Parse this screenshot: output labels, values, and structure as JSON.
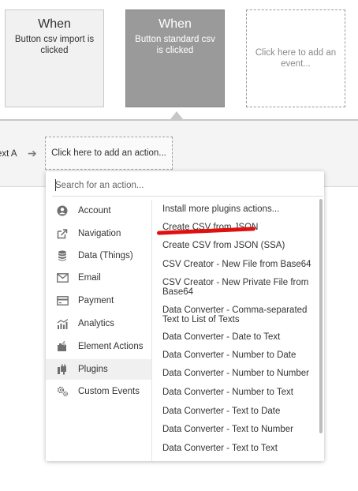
{
  "events": [
    {
      "when": "When",
      "desc": "Button csv import is clicked"
    },
    {
      "when": "When",
      "desc": "Button standard csv is clicked"
    },
    {
      "add_text": "Click here to add an event..."
    }
  ],
  "action_bar": {
    "step_label": "ext A",
    "add_action": "Click here to add an action..."
  },
  "search": {
    "placeholder": "Search for an action..."
  },
  "categories": [
    {
      "label": "Account",
      "icon": "account-icon"
    },
    {
      "label": "Navigation",
      "icon": "navigation-icon"
    },
    {
      "label": "Data (Things)",
      "icon": "database-icon"
    },
    {
      "label": "Email",
      "icon": "email-icon"
    },
    {
      "label": "Payment",
      "icon": "payment-icon"
    },
    {
      "label": "Analytics",
      "icon": "analytics-icon"
    },
    {
      "label": "Element Actions",
      "icon": "element-actions-icon"
    },
    {
      "label": "Plugins",
      "icon": "plugins-icon",
      "active": true
    },
    {
      "label": "Custom Events",
      "icon": "custom-events-icon"
    }
  ],
  "actions": [
    "Install more plugins actions...",
    "Create CSV from JSON",
    "Create CSV from JSON (SSA)",
    "CSV Creator - New File from Base64",
    "CSV Creator - New Private File from Base64",
    "Data Converter - Comma-separated Text to List of Texts",
    "Data Converter - Date to Text",
    "Data Converter - Number to Date",
    "Data Converter - Number to Number",
    "Data Converter - Number to Text",
    "Data Converter - Text to Date",
    "Data Converter - Text to Number",
    "Data Converter - Text to Text"
  ],
  "colors": {
    "highlight": "#e01010",
    "selected_card": "#9a9a9a"
  }
}
